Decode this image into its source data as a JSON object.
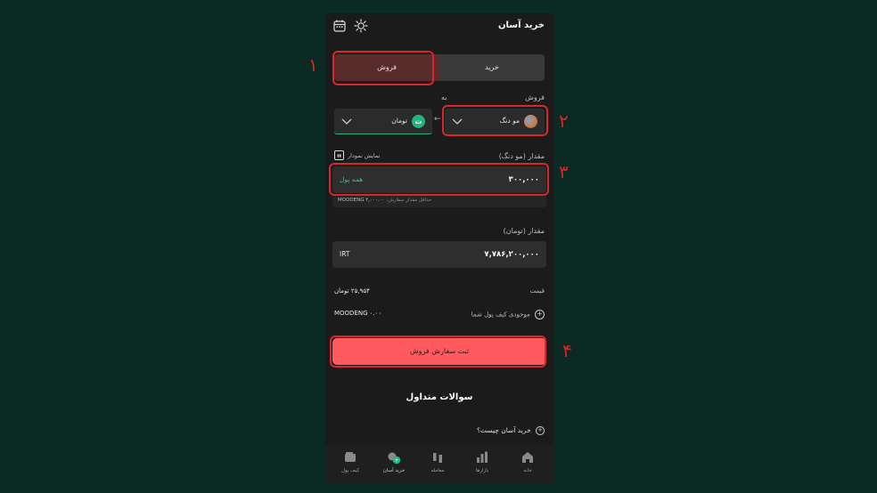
{
  "header": {
    "title": "خرید آسان"
  },
  "toggle": {
    "buy": "خرید",
    "sell": "فروش"
  },
  "from_label": "فروش",
  "to_label": "به",
  "from_coin": "مو دنگ",
  "to_coin": "تومان",
  "to_coin_glyph": "ت",
  "arrow": "←",
  "amount_label": "مقدار (مو دنگ)",
  "chart_toggle": "نمایش نمودار",
  "amount_value": "۳۰۰,۰۰۰",
  "all_money": "همه پول",
  "hint_key": "حداقل مقدار سفارش:",
  "hint_value": "MOODENG ۴,۰۰۰.۰۰",
  "toman_label": "مقدار (تومان)",
  "toman_value": "۷,۷۸۶,۲۰۰,۰۰۰",
  "toman_unit": "IRT",
  "price_label": "قیمت",
  "price_value": "۲۵,۹۵۴ تومان",
  "wallet_label": "موجودی کیف پول شما",
  "wallet_value": "MOODENG ۰.۰۰",
  "submit": "ثبت سفارش فروش",
  "faq_title": "سوالات متداول",
  "faq_item": "خرید آسان چیست؟",
  "nav": {
    "home": "خانه",
    "markets": "بازارها",
    "trade": "معامله",
    "easy": "خرید آسان",
    "wallet": "کیف پول"
  },
  "markers": [
    "۱",
    "۲",
    "۳",
    "۴"
  ],
  "colors": {
    "accent": "#ff5a5f",
    "green": "#21b57f",
    "highlight": "#d9262a"
  }
}
